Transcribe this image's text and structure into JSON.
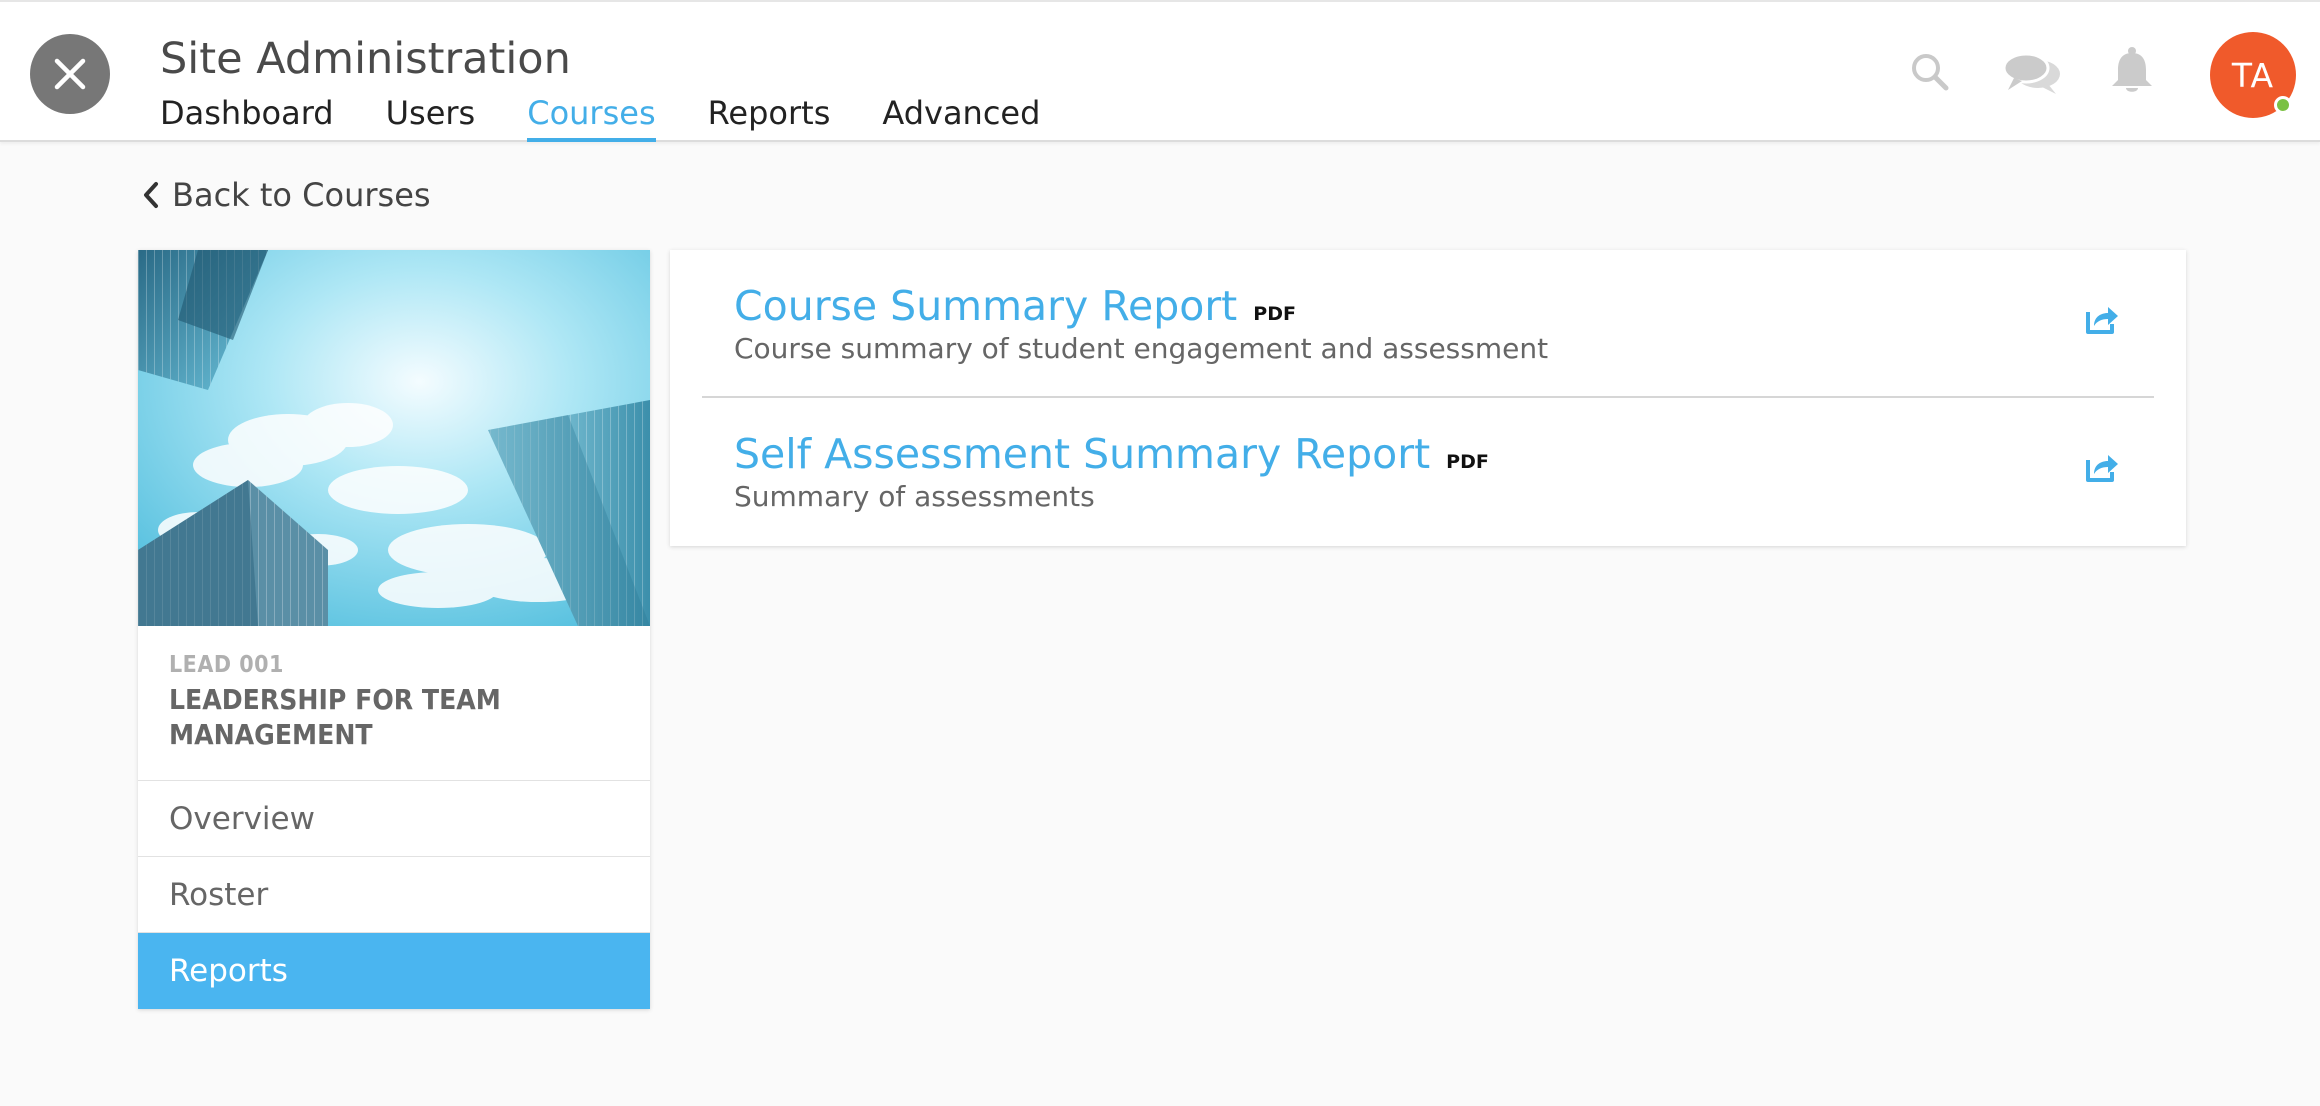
{
  "app": {
    "title": "Site Administration"
  },
  "nav": {
    "tabs": [
      {
        "label": "Dashboard",
        "active": false
      },
      {
        "label": "Users",
        "active": false
      },
      {
        "label": "Courses",
        "active": true
      },
      {
        "label": "Reports",
        "active": false
      },
      {
        "label": "Advanced",
        "active": false
      }
    ]
  },
  "header_icons": [
    "close-icon",
    "search-icon",
    "chat-icon",
    "bell-icon"
  ],
  "user": {
    "initials": "TA",
    "avatar_color": "#f05a2b",
    "status": "online",
    "status_color": "#7ac143"
  },
  "back_link": {
    "label": "Back to Courses"
  },
  "course": {
    "code": "LEAD 001",
    "name": "LEADERSHIP FOR TEAM MANAGEMENT",
    "image": "skyscrapers-sky-image",
    "menu": [
      {
        "label": "Overview",
        "active": false
      },
      {
        "label": "Roster",
        "active": false
      },
      {
        "label": "Reports",
        "active": true
      }
    ]
  },
  "reports": [
    {
      "title": "Course Summary Report",
      "badge": "PDF",
      "description": "Course summary of student engagement and assessment",
      "action_icon": "export-icon"
    },
    {
      "title": "Self Assessment Summary Report",
      "badge": "PDF",
      "description": "Summary of assessments",
      "action_icon": "export-icon"
    }
  ],
  "colors": {
    "accent": "#43aee8",
    "active_menu": "#4ab5f0",
    "background": "#fafafa"
  }
}
